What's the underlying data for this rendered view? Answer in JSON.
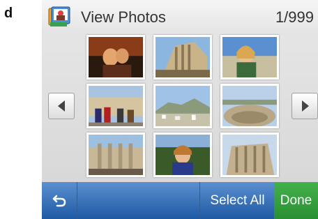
{
  "figure_label": "d",
  "header": {
    "title": "View Photos",
    "counter": "1/999"
  },
  "toolbar": {
    "select_all_label": "Select All",
    "done_label": "Done"
  },
  "colors": {
    "toolbar_blue": "#1f5aa4",
    "done_green": "#2a8f33"
  }
}
